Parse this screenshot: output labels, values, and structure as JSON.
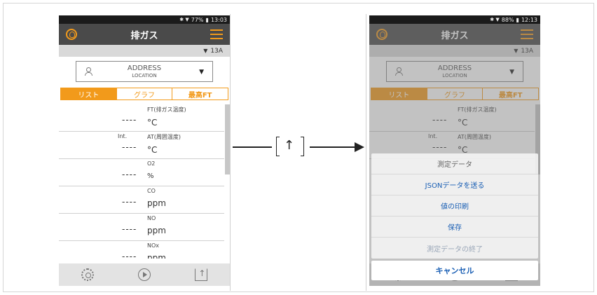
{
  "left_phone": {
    "status": {
      "signal": "✱ ▼",
      "battery": "77%",
      "time": "13:03"
    },
    "title": "排ガス",
    "fuel": "13A",
    "address": {
      "line1": "ADDRESS",
      "line2": "LOCATION"
    },
    "tabs": [
      "リスト",
      "グラフ",
      "最高FT"
    ],
    "rows": [
      {
        "label": "FT(排ガス温度)",
        "value": "----",
        "unit": "°C",
        "prefix": ""
      },
      {
        "label": "AT(周囲温度)",
        "value": "----",
        "unit": "°C",
        "prefix": "Int."
      },
      {
        "label": "O2",
        "value": "----",
        "unit": "%",
        "prefix": ""
      },
      {
        "label": "CO",
        "value": "----",
        "unit": "ppm",
        "prefix": ""
      },
      {
        "label": "NO",
        "value": "----",
        "unit": "ppm",
        "prefix": ""
      },
      {
        "label": "NOx",
        "value": "----",
        "unit": "ppm",
        "prefix": ""
      }
    ]
  },
  "right_phone": {
    "status": {
      "signal": "✱ ▼",
      "battery": "88%",
      "time": "12:13"
    },
    "title": "排ガス",
    "fuel": "13A",
    "address": {
      "line1": "ADDRESS",
      "line2": "LOCATION"
    },
    "tabs": [
      "リスト",
      "グラフ",
      "最高FT"
    ],
    "rows": [
      {
        "label": "FT(排ガス温度)",
        "value": "----",
        "unit": "°C",
        "prefix": ""
      },
      {
        "label": "AT(周囲温度)",
        "value": "----",
        "unit": "°C",
        "prefix": "Int."
      }
    ],
    "sheet": {
      "header": "測定データ",
      "items": [
        "JSONデータを送る",
        "値の印刷",
        "保存",
        "測定データの終了"
      ],
      "cancel": "キャンセル"
    }
  },
  "colors": {
    "accent": "#f29a1b",
    "titlebar": "#4a4a4a",
    "action": "#1a5fb4"
  }
}
